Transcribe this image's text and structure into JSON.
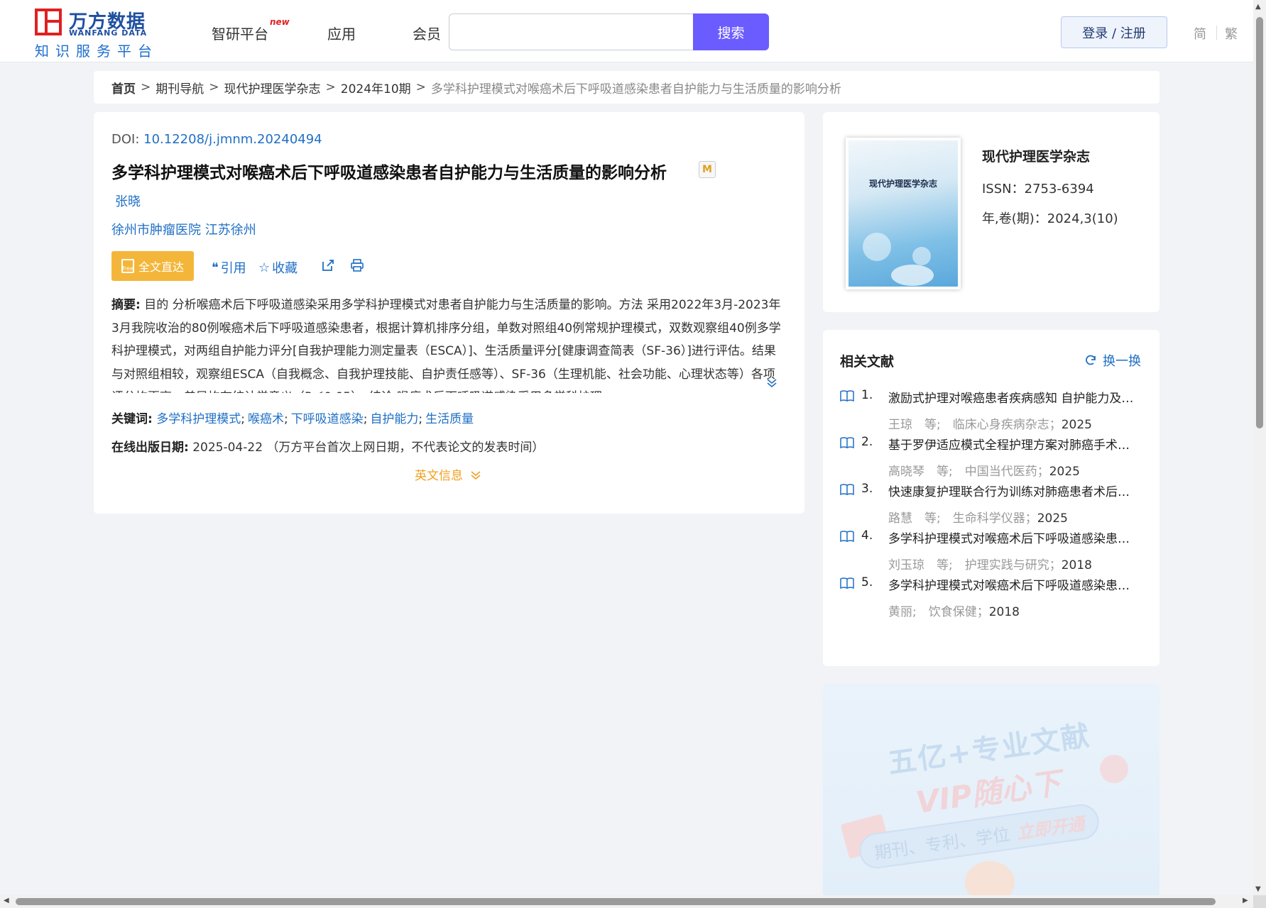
{
  "header": {
    "logo_name": "万方数据",
    "logo_en": "WANFANG DATA",
    "logo_slogan": "知识服务平台",
    "nav": [
      {
        "label": "智研平台",
        "badge": "new"
      },
      {
        "label": "应用"
      },
      {
        "label": "会员"
      }
    ],
    "search": {
      "value": "",
      "placeholder": "",
      "button": "搜索"
    },
    "login": "登录 / 注册",
    "lang_simplified": "简",
    "lang_traditional": "繁"
  },
  "breadcrumb": {
    "home": "首页",
    "items": [
      "期刊导航",
      "现代护理医学杂志",
      "2024年10期"
    ],
    "current": "多学科护理模式对喉癌术后下呼吸道感染患者自护能力与生活质量的影响分析",
    "separator": ">"
  },
  "article": {
    "doi_label": "DOI:",
    "doi": "10.12208/j.jmnm.20240494",
    "title": "多学科护理模式对喉癌术后下呼吸道感染患者自护能力与生活质量的影响分析",
    "title_badge": "M",
    "author": "张晓",
    "affiliation": "徐州市肿瘤医院 江苏徐州",
    "fulltext_button": "全文直达",
    "fulltext_icon_text": "free",
    "actions": {
      "cite": "引用",
      "favorite": "收藏"
    },
    "abstract_label": "摘要:",
    "abstract": "目的 分析喉癌术后下呼吸道感染采用多学科护理模式对患者自护能力与生活质量的影响。方法 采用2022年3月-2023年3月我院收治的80例喉癌术后下呼吸道感染患者，根据计算机排序分组，单数对照组40例常规护理模式，双数观察组40例多学科护理模式，对两组自护能力评分[自我护理能力测定量表（ESCA）]、生活质量评分[健康调查简表（SF-36）]进行评估。结果 与对照组相较，观察组ESCA（自我概念、自我护理技能、自护责任感等）、SF-36（生理机能、社会功能、心理状态等）各项评分均更高，差异均有统计学意义（P＜0.05）。结论 喉癌术后下呼吸道感染采用多学科护理...",
    "keywords_label": "关键词:",
    "keywords": [
      "多学科护理模式",
      "喉癌术",
      "下呼吸道感染",
      "自护能力",
      "生活质量"
    ],
    "keyword_separator": ";",
    "pubdate_label": "在线出版日期:",
    "pubdate": "2025-04-22",
    "pubdate_note": "（万方平台首次上网日期，不代表论文的发表时间）",
    "english_info": "英文信息"
  },
  "journal": {
    "cover_title": "现代护理医学杂志",
    "name": "现代护理医学杂志",
    "issn": "ISSN：2753-6394",
    "volume": "年,卷(期)：2024,3(10)"
  },
  "related": {
    "title": "相关文献",
    "refresh": "换一换",
    "items": [
      {
        "num": "1.",
        "title": "激励式护理对喉癌患者疾病感知 自护能力及生活质量的影响",
        "meta": "王琼　等;　临床心身疾病杂志；",
        "year": "2025"
      },
      {
        "num": "2.",
        "title": "基于罗伊适应模式全程护理方案对肺癌手术患者的影响",
        "meta": "高晓琴　等;　中国当代医药；",
        "year": "2025"
      },
      {
        "num": "3.",
        "title": "快速康复护理联合行为训练对肺癌患者术后康复的影响",
        "meta": "路慧　等;　生命科学仪器；",
        "year": "2025"
      },
      {
        "num": "4.",
        "title": "多学科护理模式对喉癌术后下呼吸道感染患者的影响",
        "meta": "刘玉琼　等;　护理实践与研究；",
        "year": "2018"
      },
      {
        "num": "5.",
        "title": "多学科护理模式对喉癌术后下呼吸道感染患者的效果",
        "meta": "黄丽;　饮食保健；",
        "year": "2018"
      }
    ]
  },
  "ad": {
    "line1": "五亿+专业文献",
    "line2": "VIP随心下",
    "line3": "期刊、专利、学位",
    "line3_highlight": "立即开通"
  },
  "colors": {
    "link": "#1f6fc5",
    "search_button": "#6b5cff",
    "fulltext_button": "#f4b63a",
    "english_info": "#f0a020",
    "logo_red": "#e02020",
    "logo_blue": "#1e4fa0"
  }
}
